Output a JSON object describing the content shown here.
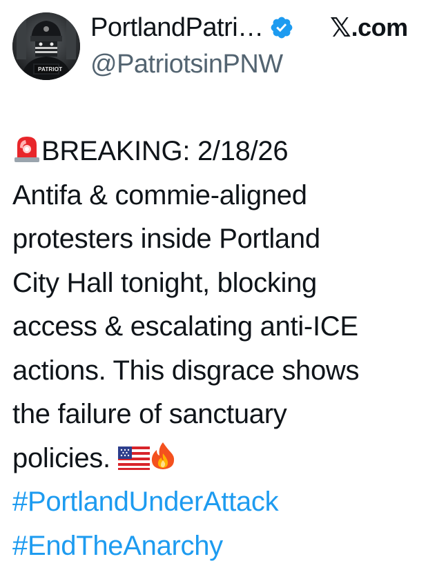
{
  "author": {
    "display_name": "PortlandPatri…",
    "handle": "@PatriotsinPNW",
    "avatar_badge_text": "PATRIOT",
    "verified": true
  },
  "source": {
    "logo_icon": "x-logo-icon",
    "logo_glyph": "𝕏",
    "label": ".com"
  },
  "tweet": {
    "line1": "BREAKING: 2/18/26",
    "line2": "Antifa & commie-aligned",
    "line3": "protesters inside Portland",
    "line4": "City Hall tonight, blocking",
    "line5": "access & escalating anti-ICE",
    "line6": "actions. This disgrace shows",
    "line7": "the failure of sanctuary",
    "line8": "policies.",
    "hashtags": [
      "#PortlandUnderAttack",
      "#EndTheAnarchy"
    ]
  },
  "icons": {
    "line1_leading": "siren-emoji-icon",
    "line8_trailing": [
      "us-flag-emoji-icon",
      "fire-emoji-icon"
    ]
  },
  "colors": {
    "text": "#0f1419",
    "handle": "#536471",
    "hashtag": "#1d9bf0",
    "verified": "#1d9bf0",
    "background": "#ffffff"
  }
}
